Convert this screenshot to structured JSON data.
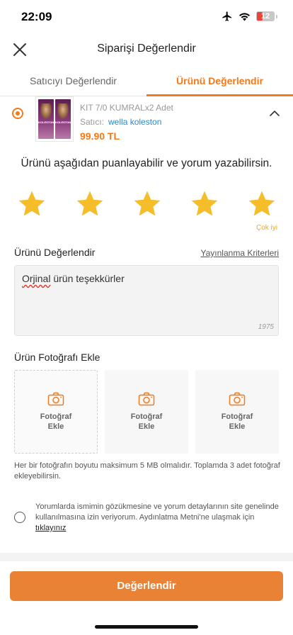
{
  "status_bar": {
    "time": "22:09",
    "battery": "12"
  },
  "header": {
    "title": "Siparişi Değerlendir"
  },
  "tabs": [
    {
      "label": "Satıcıyı Değerlendir",
      "active": false
    },
    {
      "label": "Ürünü Değerlendir",
      "active": true
    }
  ],
  "product": {
    "name": "KIT 7/0 KUMRALx2 Adet",
    "seller_label": "Satıcı:",
    "seller_name": "wella koleston",
    "price": "99.90 TL"
  },
  "prompt": "Ürünü aşağıdan puanlayabilir ve yorum yazabilirsin.",
  "rating": {
    "value": 5,
    "max": 5,
    "caption": "Çok iyi",
    "color": "#f5bd2a"
  },
  "review": {
    "label": "Ürünü Değerlendir",
    "criteria_link": "Yayınlanma Kriterleri",
    "text_misspelled": "Orjinal",
    "text_rest": " ürün teşekkürler",
    "char_count": "1975"
  },
  "photos": {
    "label": "Ürün Fotoğrafı Ekle",
    "slot_label_line1": "Fotoğraf",
    "slot_label_line2": "Ekle",
    "info": "Her bir fotoğrafın boyutu maksimum 5 MB olmalıdır. Toplamda 3 adet fotoğraf ekleyebilirsin."
  },
  "consent": {
    "text": "Yorumlarda ismimin gözükmesine ve yorum detaylarının site genelinde kullanılmasına izin veriyorum. Aydınlatma Metni'ne ulaşmak için ",
    "link": "tıklayınız"
  },
  "submit_label": "Değerlendir",
  "colors": {
    "accent": "#f27a1a",
    "button": "#ea8236",
    "link": "#2f88c9"
  },
  "icons": [
    "close-icon",
    "chevron-up-icon",
    "star-icon",
    "camera-icon",
    "airplane-icon",
    "wifi-icon",
    "battery-icon"
  ]
}
